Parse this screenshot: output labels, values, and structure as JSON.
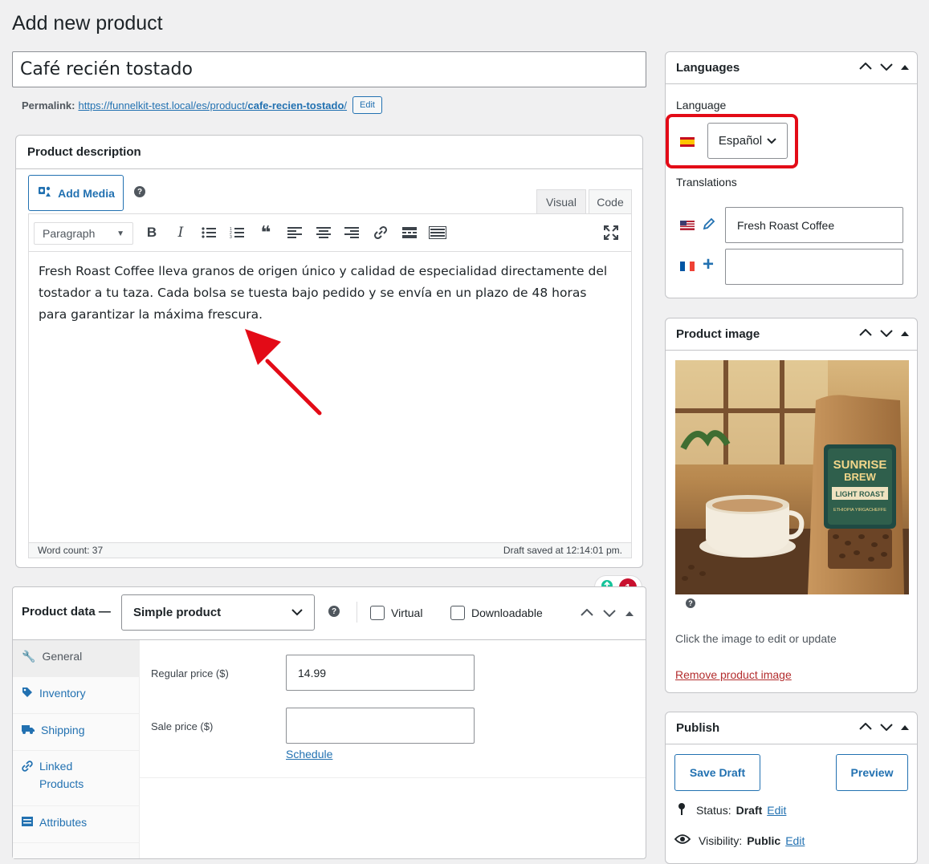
{
  "page": {
    "title": "Add new product"
  },
  "product": {
    "title": "Café recién tostado",
    "permalink_label": "Permalink:",
    "permalink_base": "https://funnelkit-test.local/es/product/",
    "permalink_slug": "cafe-recien-tostado",
    "permalink_trailing": "/",
    "permalink_edit": "Edit"
  },
  "description": {
    "title": "Product description",
    "add_media": "Add Media",
    "tab_visual": "Visual",
    "tab_code": "Code",
    "format_select": "Paragraph",
    "content": "Fresh Roast Coffee lleva granos de origen único y calidad de especialidad directamente del tostador a tu taza. Cada bolsa se tuesta bajo pedido y se envía en un plazo de 48 horas para garantizar la máxima frescura.",
    "word_count": "Word count: 37",
    "draft_saved": "Draft saved at 12:14:01 pm.",
    "grammar_count": "1"
  },
  "product_data": {
    "title": "Product data —",
    "type": "Simple product",
    "virtual_label": "Virtual",
    "downloadable_label": "Downloadable",
    "nav": [
      {
        "label": "General",
        "icon": "wrench-icon"
      },
      {
        "label": "Inventory",
        "icon": "tag-icon"
      },
      {
        "label": "Shipping",
        "icon": "truck-icon"
      },
      {
        "label": "Linked Products",
        "icon": "link-icon"
      },
      {
        "label": "Attributes",
        "icon": "list-icon"
      }
    ],
    "regular_price_label": "Regular price ($)",
    "regular_price": "14.99",
    "sale_price_label": "Sale price ($)",
    "sale_price": "",
    "schedule_link": "Schedule"
  },
  "languages": {
    "title": "Languages",
    "language_label": "Language",
    "current_language": "Español",
    "translations_label": "Translations",
    "translations": [
      {
        "flag": "us-flag-icon",
        "action": "pencil-icon",
        "value": "Fresh Roast Coffee"
      },
      {
        "flag": "fr-flag-icon",
        "action": "plus-icon",
        "value": ""
      }
    ]
  },
  "product_image": {
    "title": "Product image",
    "hint": "Click the image to edit or update",
    "remove_link": "Remove product image",
    "bag_brand_line1": "SUNRISE",
    "bag_brand_line2": "BREW",
    "bag_roast": "LIGHT ROAST",
    "bag_origin": "ETHIOPIA YIRGACHEFFE"
  },
  "publish": {
    "title": "Publish",
    "save_draft": "Save Draft",
    "preview": "Preview",
    "status_label": "Status:",
    "status_value": "Draft",
    "status_edit": "Edit",
    "visibility_label": "Visibility:",
    "visibility_value": "Public",
    "visibility_edit": "Edit"
  },
  "colors": {
    "accent": "#2271b1",
    "highlight": "#e30b17",
    "annotation_arrow": "#e30b17"
  }
}
